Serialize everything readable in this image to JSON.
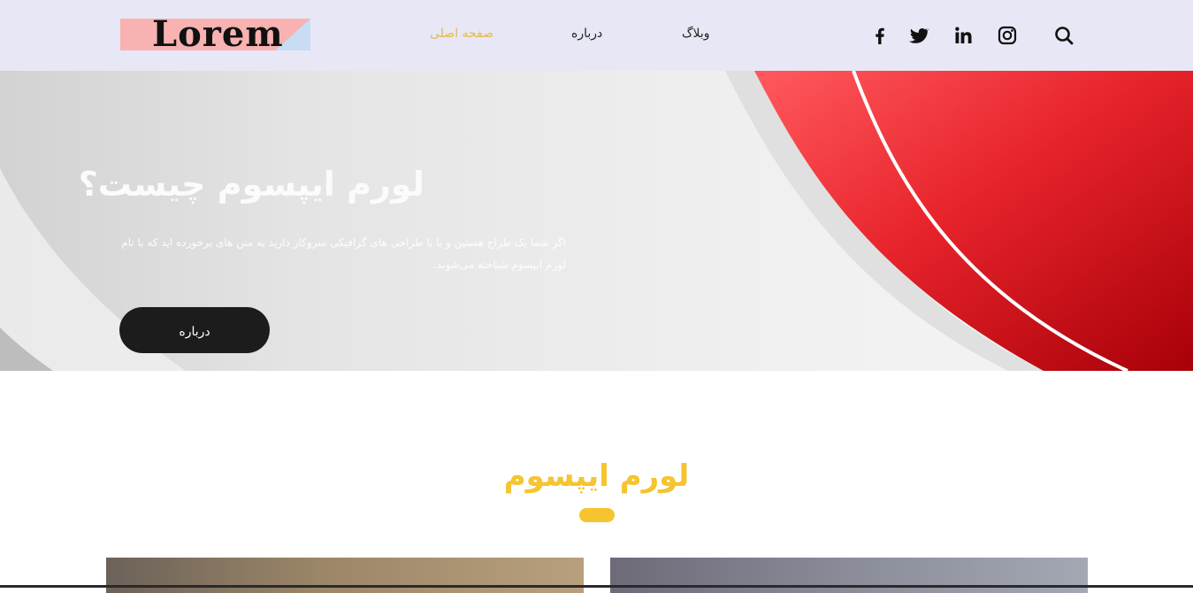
{
  "header": {
    "logo_text": "Lorem",
    "nav": [
      {
        "label": "صفحه اصلی",
        "active": true
      },
      {
        "label": "درباره",
        "active": false
      },
      {
        "label": "وبلاگ",
        "active": false
      }
    ],
    "social_icons": [
      "facebook-icon",
      "twitter-icon",
      "linkedin-icon",
      "instagram-icon"
    ],
    "search_icon": "search-icon"
  },
  "hero": {
    "title": "لورم ایپسوم چیست؟",
    "text": "اگر شما یک طراح هستین و یا با طراحی های گرافیکی سروکار دارید به متن های برخورده اید که با نام لورم ایپسوم شناخته می‌شوند.",
    "button_label": "درباره"
  },
  "section": {
    "title": "لورم ایپسوم"
  },
  "colors": {
    "header_bg": "#e8e7f5",
    "accent": "#f6c42e",
    "nav_active": "#e5b94a",
    "button_bg": "#1c1c1c",
    "hero_red": "#e8242c"
  }
}
